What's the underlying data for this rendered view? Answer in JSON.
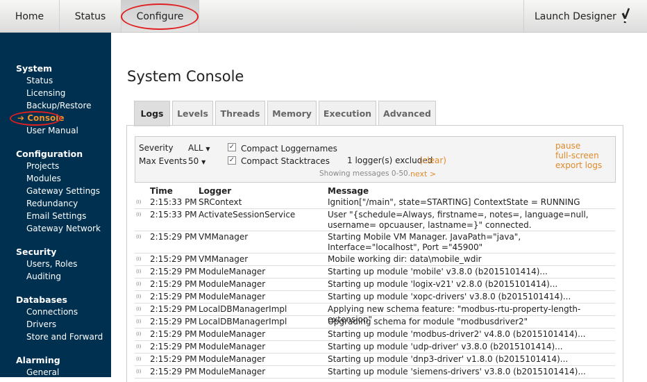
{
  "nav": {
    "home": "Home",
    "status": "Status",
    "configure": "Configure",
    "launch": "Launch Designer",
    "launch_icon": "wrench-screwdriver-icon"
  },
  "sidebar": [
    {
      "heading": "System",
      "items": [
        "Status",
        "Licensing",
        "Backup/Restore",
        "Console",
        "User Manual"
      ]
    },
    {
      "heading": "Configuration",
      "items": [
        "Projects",
        "Modules",
        "Gateway Settings",
        "Redundancy",
        "Email Settings",
        "Gateway Network"
      ]
    },
    {
      "heading": "Security",
      "items": [
        "Users, Roles",
        "Auditing"
      ]
    },
    {
      "heading": "Databases",
      "items": [
        "Connections",
        "Drivers",
        "Store and Forward"
      ]
    },
    {
      "heading": "Alarming",
      "items": [
        "General"
      ]
    }
  ],
  "active_item": "Console",
  "page_title": "System Console",
  "tabs": [
    "Logs",
    "Levels",
    "Threads",
    "Memory",
    "Execution",
    "Advanced"
  ],
  "filters": {
    "severity_label": "Severity",
    "severity_value": "ALL",
    "max_label": "Max Events",
    "max_value": "50",
    "compact_loggernames": "Compact Loggernames",
    "compact_stacktraces": "Compact Stacktraces",
    "excluded": "1 logger(s) excluded",
    "clear": "(clear)",
    "showing": "Showing messages 0-50.",
    "next": "next >",
    "pause": "pause",
    "fullscreen": "full-screen",
    "export": "export logs"
  },
  "columns": [
    "Time",
    "Logger",
    "Message"
  ],
  "rows": [
    {
      "level": "(I)",
      "time": "2:15:33 PM",
      "logger": "SRContext",
      "message": "Ignition[\"/main\", state=STARTING] ContextState = RUNNING"
    },
    {
      "level": "(I)",
      "time": "2:15:33 PM",
      "logger": "ActivateSessionService",
      "message": "User \"{schedule=Always, firstname=, notes=, language=null, username= opcuauser, lastname=}\" connected."
    },
    {
      "level": "(I)",
      "time": "2:15:29 PM",
      "logger": "VMManager",
      "message": "Starting Mobile VM Manager. JavaPath=\"java\", Interface=\"localhost\", Port =\"45900\""
    },
    {
      "level": "(I)",
      "time": "2:15:29 PM",
      "logger": "VMManager",
      "message": "Mobile working dir: data\\mobile_wdir"
    },
    {
      "level": "(I)",
      "time": "2:15:29 PM",
      "logger": "ModuleManager",
      "message": "Starting up module 'mobile' v3.8.0 (b2015101414)..."
    },
    {
      "level": "(I)",
      "time": "2:15:29 PM",
      "logger": "ModuleManager",
      "message": "Starting up module 'logix-v21' v2.8.0 (b2015101414)..."
    },
    {
      "level": "(I)",
      "time": "2:15:29 PM",
      "logger": "ModuleManager",
      "message": "Starting up module 'xopc-drivers' v3.8.0 (b2015101414)..."
    },
    {
      "level": "(I)",
      "time": "2:15:29 PM",
      "logger": "LocalDBManagerImpl",
      "message": "Applying new schema feature: \"modbus-rtu-property-length-extension\""
    },
    {
      "level": "(I)",
      "time": "2:15:29 PM",
      "logger": "LocalDBManagerImpl",
      "message": "Upgrading schema for module \"modbusdriver2\""
    },
    {
      "level": "(I)",
      "time": "2:15:29 PM",
      "logger": "ModuleManager",
      "message": "Starting up module 'modbus-driver2' v4.8.0 (b2015101414)..."
    },
    {
      "level": "(I)",
      "time": "2:15:29 PM",
      "logger": "ModuleManager",
      "message": "Starting up module 'udp-driver' v3.8.0 (b2015101414)..."
    },
    {
      "level": "(I)",
      "time": "2:15:29 PM",
      "logger": "ModuleManager",
      "message": "Starting up module 'dnp3-driver' v1.8.0 (b2015101414)..."
    },
    {
      "level": "(I)",
      "time": "2:15:29 PM",
      "logger": "ModuleManager",
      "message": "Starting up module 'siemens-drivers' v3.8.0 (b2015101414)..."
    }
  ]
}
